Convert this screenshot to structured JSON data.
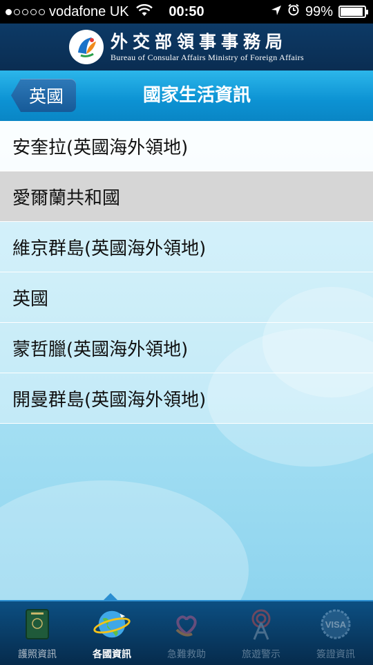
{
  "status": {
    "carrier": "vodafone UK",
    "time": "00:50",
    "battery": "99%",
    "battery_level": 0.99,
    "signal_bars_filled": 1,
    "signal_bars_total": 5
  },
  "header": {
    "title": "外交部領事事務局",
    "subtitle": "Bureau of Consular Affairs Ministry of Foreign Affairs"
  },
  "nav": {
    "back_label": "英國",
    "title": "國家生活資訊"
  },
  "list": {
    "items": [
      {
        "label": "安奎拉(英國海外領地)"
      },
      {
        "label": "愛爾蘭共和國"
      },
      {
        "label": "維京群島(英國海外領地)"
      },
      {
        "label": "英國"
      },
      {
        "label": "蒙哲臘(英國海外領地)"
      },
      {
        "label": "開曼群島(英國海外領地)"
      }
    ],
    "selected_index": 1
  },
  "tabbar": {
    "tabs": [
      {
        "label": "護照資訊",
        "icon": "passport-icon"
      },
      {
        "label": "各國資訊",
        "icon": "globe-icon"
      },
      {
        "label": "急難救助",
        "icon": "heart-hands-icon"
      },
      {
        "label": "旅遊警示",
        "icon": "alert-tower-icon"
      },
      {
        "label": "簽證資訊",
        "icon": "visa-badge-icon"
      }
    ],
    "active_index": 1
  },
  "colors": {
    "header_bg": "#0a2d52",
    "nav_accent": "#0c92d3",
    "list_bg": "#a8e1f4",
    "selected_row": "#d6d6d6"
  }
}
